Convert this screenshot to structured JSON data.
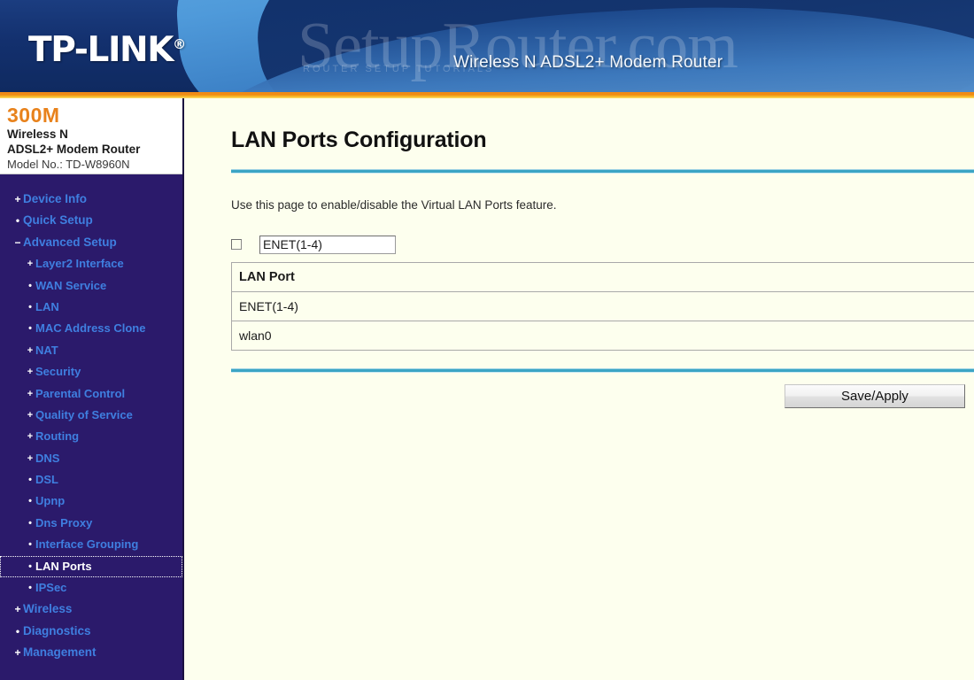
{
  "header": {
    "brand": "TP-LINK",
    "brand_reg": "®",
    "tagline": "Wireless N ADSL2+ Modem Router",
    "watermark": "SetupRouter.com",
    "watermark_sub": "ROUTER SETUP TUTORIALS"
  },
  "sidebar": {
    "speed": "300M",
    "line1": "Wireless N",
    "line2": "ADSL2+ Modem Router",
    "model": "Model No.: TD-W8960N",
    "items": [
      {
        "label": "Device Info",
        "bullet": "+",
        "level": 0,
        "selected": false
      },
      {
        "label": "Quick Setup",
        "bullet": "•",
        "level": 0,
        "selected": false
      },
      {
        "label": "Advanced Setup",
        "bullet": "−",
        "level": 0,
        "selected": false
      },
      {
        "label": "Layer2 Interface",
        "bullet": "+",
        "level": 1,
        "selected": false
      },
      {
        "label": "WAN Service",
        "bullet": "•",
        "level": 1,
        "selected": false
      },
      {
        "label": "LAN",
        "bullet": "•",
        "level": 1,
        "selected": false
      },
      {
        "label": "MAC Address Clone",
        "bullet": "•",
        "level": 1,
        "selected": false
      },
      {
        "label": "NAT",
        "bullet": "+",
        "level": 1,
        "selected": false
      },
      {
        "label": "Security",
        "bullet": "+",
        "level": 1,
        "selected": false
      },
      {
        "label": "Parental Control",
        "bullet": "+",
        "level": 1,
        "selected": false
      },
      {
        "label": "Quality of Service",
        "bullet": "+",
        "level": 1,
        "selected": false
      },
      {
        "label": "Routing",
        "bullet": "+",
        "level": 1,
        "selected": false
      },
      {
        "label": "DNS",
        "bullet": "+",
        "level": 1,
        "selected": false
      },
      {
        "label": "DSL",
        "bullet": "•",
        "level": 1,
        "selected": false
      },
      {
        "label": "Upnp",
        "bullet": "•",
        "level": 1,
        "selected": false
      },
      {
        "label": "Dns Proxy",
        "bullet": "•",
        "level": 1,
        "selected": false
      },
      {
        "label": "Interface Grouping",
        "bullet": "•",
        "level": 1,
        "selected": false
      },
      {
        "label": "LAN Ports",
        "bullet": "•",
        "level": 1,
        "selected": true
      },
      {
        "label": "IPSec",
        "bullet": "•",
        "level": 1,
        "selected": false
      },
      {
        "label": "Wireless",
        "bullet": "+",
        "level": 0,
        "selected": false
      },
      {
        "label": "Diagnostics",
        "bullet": "•",
        "level": 0,
        "selected": false
      },
      {
        "label": "Management",
        "bullet": "+",
        "level": 0,
        "selected": false
      }
    ]
  },
  "main": {
    "title": "LAN Ports Configuration",
    "intro": "Use this page to enable/disable the Virtual LAN Ports feature.",
    "enable_checkbox": {
      "checked": false,
      "label": ""
    },
    "port_input_value": "ENET(1-4)",
    "port_input_placeholder": "",
    "table": {
      "columns": [
        "LAN Port"
      ],
      "rows": [
        [
          "ENET(1-4)"
        ],
        [
          "wlan0"
        ]
      ]
    },
    "save_button": "Save/Apply"
  },
  "colors": {
    "header_blue": "#13306e",
    "accent_orange": "#ef8b14",
    "sidebar_purple": "#2b1a6b",
    "link_blue": "#3f7fe0",
    "rule_teal": "#3ba5c4",
    "content_bg": "#fdffee",
    "speed_orange": "#e8821c"
  }
}
